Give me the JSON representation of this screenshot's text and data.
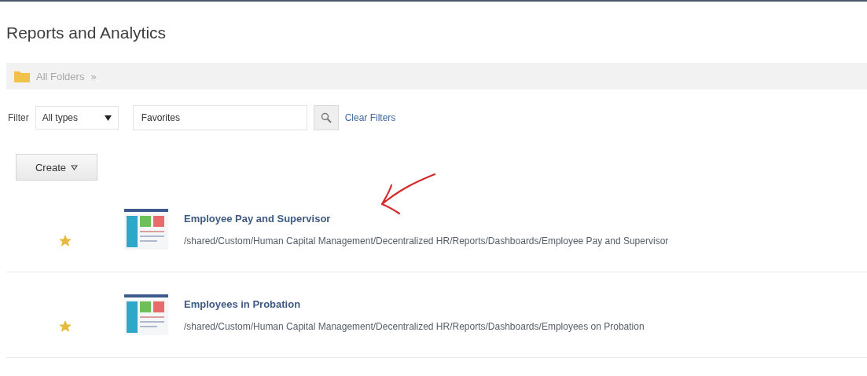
{
  "page": {
    "title": "Reports and Analytics"
  },
  "breadcrumb": {
    "label": "All Folders",
    "separator": "»"
  },
  "filter": {
    "label": "Filter",
    "type_select": "All types",
    "search_value": "Favorites",
    "clear_link": "Clear Filters"
  },
  "create_button": {
    "label": "Create"
  },
  "items": [
    {
      "title": "Employee Pay and Supervisor",
      "path": "/shared/Custom/Human Capital Management/Decentralized HR/Reports/Dashboards/Employee Pay and Supervisor",
      "favorite": true,
      "annotated": true
    },
    {
      "title": "Employees in Probation",
      "path": "/shared/Custom/Human Capital Management/Decentralized HR/Reports/Dashboards/Employees on Probation",
      "favorite": true,
      "annotated": false
    }
  ]
}
